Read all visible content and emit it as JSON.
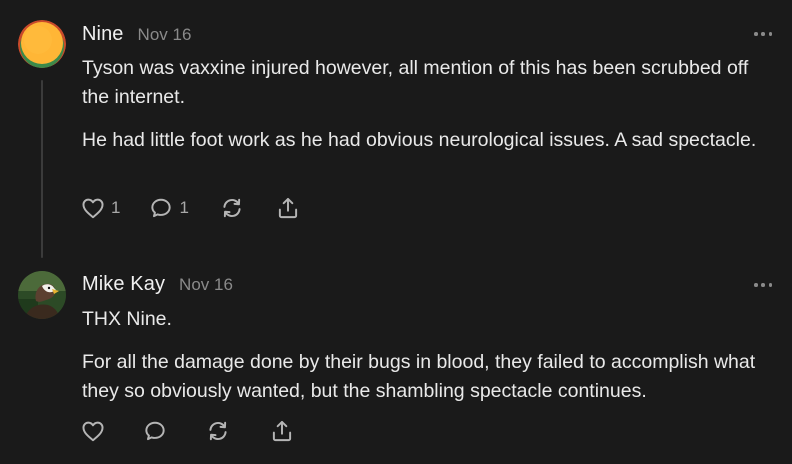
{
  "comments": [
    {
      "author": "Nine",
      "date": "Nov 16",
      "avatar": "orange-circle-avatar",
      "paragraphs": [
        "Tyson was vaxxine injured however, all mention of this has been scrubbed off the internet.",
        "He had little foot work as he had obvious neurological issues. A sad spectacle."
      ],
      "likes": "1",
      "replies": "1"
    },
    {
      "author": "Mike Kay",
      "date": "Nov 16",
      "avatar": "eagle-photo-avatar",
      "paragraphs": [
        "THX Nine.",
        "For all the damage done by their bugs in blood, they failed to accomplish what they so obviously wanted, but the shambling spectacle continues."
      ]
    }
  ],
  "icons": {
    "like": "heart-icon",
    "reply": "speech-bubble-icon",
    "restack": "restack-icon",
    "share": "share-icon",
    "more": "ellipsis-icon"
  },
  "colors": {
    "background": "#1a1a1a",
    "text": "#e9e9e9",
    "muted": "#8a8a8a",
    "icon": "#b5b5b5",
    "thread_line": "#3b3b3b"
  }
}
